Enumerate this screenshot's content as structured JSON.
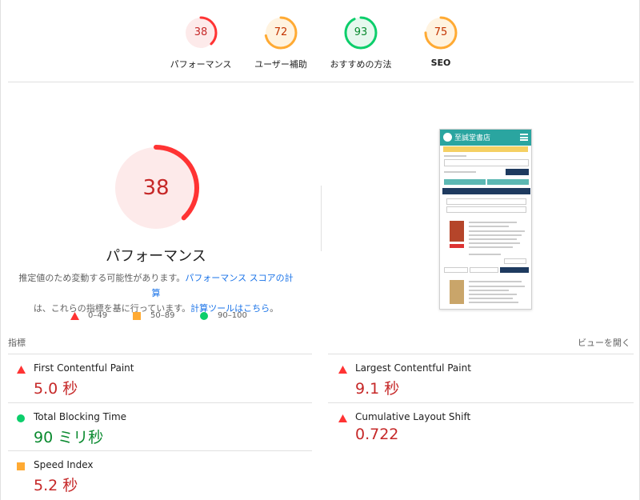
{
  "categories": [
    {
      "score": "38",
      "label": "パフォーマンス",
      "color": "#ff3333",
      "fill": "#fdeaea",
      "text_color": "#c62828",
      "fraction": 0.38
    },
    {
      "score": "72",
      "label": "ユーザー補助",
      "color": "#ffaa33",
      "fill": "#fff3e0",
      "text_color": "#c33300",
      "fraction": 0.72
    },
    {
      "score": "93",
      "label": "おすすめの方法",
      "color": "#0cce6b",
      "fill": "#e6f8ee",
      "text_color": "#0a8a2f",
      "fraction": 0.93
    },
    {
      "score": "75",
      "label": "SEO",
      "color": "#ffaa33",
      "fill": "#fff3e0",
      "text_color": "#c33300",
      "fraction": 0.75
    }
  ],
  "main": {
    "score": "38",
    "fraction": 0.38,
    "title": "パフォーマンス",
    "desc_prefix": "推定値のため変動する可能性があります。",
    "desc_link1": "パフォーマンス スコアの計算",
    "desc_middle": "は、これらの指標を基に行っています。",
    "desc_link2": "計算ツールはこちら",
    "desc_suffix": "。"
  },
  "legend": [
    {
      "shape": "triangle",
      "color": "#ff3333",
      "label": "0–49"
    },
    {
      "shape": "square",
      "color": "#ffaa33",
      "label": "50–89"
    },
    {
      "shape": "circle",
      "color": "#0cce6b",
      "label": "90–100"
    }
  ],
  "phone": {
    "title": "至誠堂書店"
  },
  "metrics": {
    "heading": "指標",
    "view_toggle": "ビューを開く",
    "items": [
      {
        "name": "First Contentful Paint",
        "value": "5.0 秒",
        "status": "red"
      },
      {
        "name": "Largest Contentful Paint",
        "value": "9.1 秒",
        "status": "red"
      },
      {
        "name": "Total Blocking Time",
        "value": "90 ミリ秒",
        "status": "green"
      },
      {
        "name": "Cumulative Layout Shift",
        "value": "0.722",
        "status": "red"
      },
      {
        "name": "Speed Index",
        "value": "5.2 秒",
        "status": "orange"
      }
    ]
  }
}
